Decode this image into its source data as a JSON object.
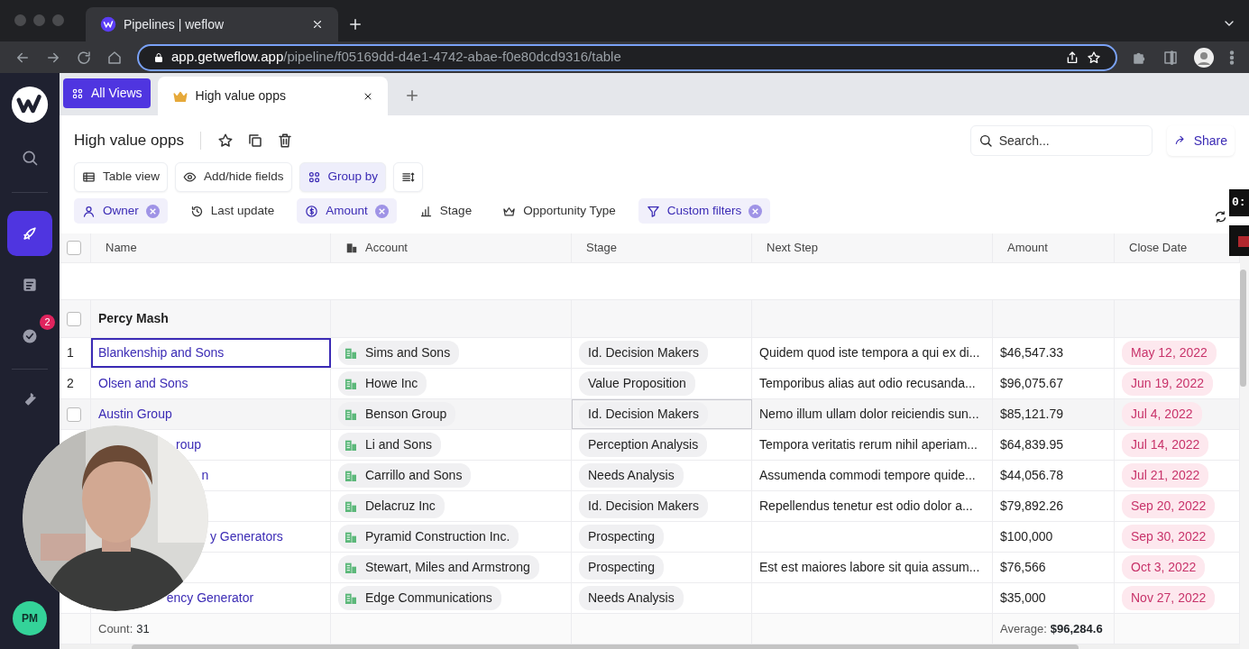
{
  "browser": {
    "tab_title": "Pipelines | weflow",
    "url_host": "app.getweflow.app",
    "url_path": "/pipeline/f05169dd-d4e1-4742-abae-f0e80dcd9316/table"
  },
  "sidebar": {
    "items": [
      {
        "kind": "search",
        "selected": false
      },
      {
        "kind": "rocket",
        "selected": true
      },
      {
        "kind": "notes",
        "selected": false
      },
      {
        "kind": "tasks",
        "selected": false,
        "badge": "2"
      },
      {
        "kind": "tools",
        "selected": false
      }
    ],
    "avatar": "PM"
  },
  "views": {
    "all_views": "All Views",
    "tabs": [
      {
        "label": "High value opps",
        "selected": true
      }
    ]
  },
  "title": "High value opps",
  "search": {
    "placeholder": "Search..."
  },
  "share": "Share",
  "toolbar": [
    {
      "kind": "table",
      "label": "Table view",
      "active": false
    },
    {
      "kind": "eye",
      "label": "Add/hide fields",
      "active": false
    },
    {
      "kind": "grid",
      "label": "Group by",
      "active": true
    },
    {
      "kind": "sort"
    }
  ],
  "filters": [
    {
      "kind": "person",
      "label": "Owner",
      "active": true
    },
    {
      "kind": "clock",
      "label": "Last update",
      "active": false
    },
    {
      "kind": "dollar",
      "label": "Amount",
      "active": true
    },
    {
      "kind": "bars",
      "label": "Stage",
      "active": false
    },
    {
      "kind": "crown",
      "label": "Opportunity Type",
      "active": false
    },
    {
      "kind": "funnel",
      "label": "Custom filters",
      "active": true
    }
  ],
  "table": {
    "columns": [
      "Name",
      "Account",
      "Stage",
      "Next Step",
      "Amount",
      "Close Date"
    ],
    "select_all_checked": false,
    "group": "Percy Mash",
    "group_checked": false,
    "rows": [
      {
        "lead": "1",
        "name": "Blankenship and Sons",
        "account": "Sims and Sons",
        "stage": "Id. Decision Makers",
        "next_step": "Quidem quod iste tempora a qui ex di...",
        "amount": "$46,547.33",
        "close_date": "May 12, 2022",
        "selected": true,
        "hovered": false
      },
      {
        "lead": "2",
        "name": "Olsen and Sons",
        "account": "Howe Inc",
        "stage": "Value Proposition",
        "next_step": "Temporibus alias aut odio recusanda...",
        "amount": "$96,075.67",
        "close_date": "Jun 19, 2022",
        "selected": false,
        "hovered": false
      },
      {
        "checked": false,
        "name": "Austin Group",
        "account": "Benson Group",
        "stage": "Id. Decision Makers",
        "next_step": "Nemo illum ullam dolor reiciendis sun...",
        "amount": "$85,121.79",
        "close_date": "Jul 4, 2022",
        "selected": false,
        "hovered": true
      },
      {
        "name": "roup",
        "account": "Li and Sons",
        "stage": "Perception Analysis",
        "next_step": "Tempora veritatis rerum nihil aperiam...",
        "amount": "$64,839.95",
        "close_date": "Jul 14, 2022",
        "selected": false,
        "hovered": false
      },
      {
        "name": "n",
        "account": "Carrillo and Sons",
        "stage": "Needs Analysis",
        "next_step": "Assumenda commodi tempore quide...",
        "amount": "$44,056.78",
        "close_date": "Jul 21, 2022",
        "selected": false,
        "hovered": false
      },
      {
        "account": "Delacruz Inc",
        "stage": "Id. Decision Makers",
        "next_step": "Repellendus tenetur est odio dolor a...",
        "amount": "$79,892.26",
        "close_date": "Sep 20, 2022",
        "selected": false,
        "hovered": false
      },
      {
        "name": "y Generators",
        "account": "Pyramid Construction Inc.",
        "stage": "Prospecting",
        "amount": "$100,000",
        "close_date": "Sep 30, 2022",
        "selected": false,
        "hovered": false
      },
      {
        "account": "Stewart, Miles and Armstrong",
        "stage": "Prospecting",
        "next_step": "Est est maiores labore sit quia assum...",
        "amount": "$76,566",
        "close_date": "Oct 3, 2022",
        "selected": false,
        "hovered": false
      },
      {
        "name": "ency Generator",
        "account": "Edge Communications",
        "stage": "Needs Analysis",
        "amount": "$35,000",
        "close_date": "Nov 27, 2022",
        "selected": false,
        "hovered": false
      }
    ],
    "footer": {
      "count_label": "Count:",
      "count": "31",
      "average_label": "Average:",
      "average": "$96,284.6"
    }
  },
  "recorder": {
    "timer": "0:"
  }
}
